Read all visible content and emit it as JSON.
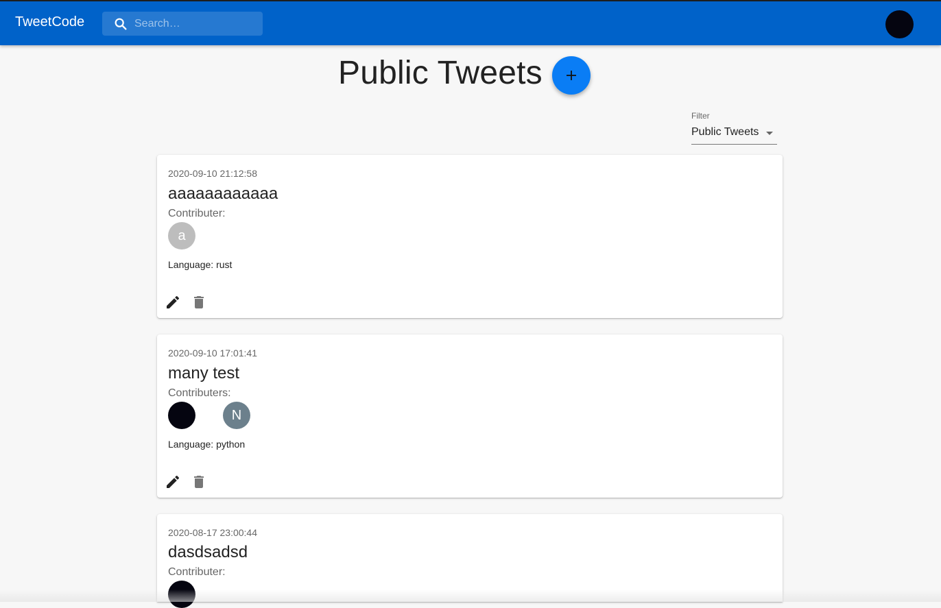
{
  "appbar": {
    "brand": "TweetCode",
    "search_placeholder": "Search…",
    "brand_color": "#0062c9"
  },
  "page": {
    "title": "Public Tweets"
  },
  "filter": {
    "label": "Filter",
    "selected": "Public Tweets"
  },
  "tweets": [
    {
      "date": "2020-09-10 21:12:58",
      "title": "aaaaaaaaaaaa",
      "contributors_label": "Contributer:",
      "contributors": [
        {
          "initial": "a",
          "color": "#bdbdbd"
        }
      ],
      "language": "Language: rust"
    },
    {
      "date": "2020-09-10 17:01:41",
      "title": "many test",
      "contributors_label": "Contributers:",
      "contributors": [
        {
          "initial": "",
          "color": "#050510"
        },
        {
          "initial": "N",
          "color": "#6c808c"
        }
      ],
      "language": "Language: python"
    },
    {
      "date": "2020-08-17 23:00:44",
      "title": "dasdsadsd",
      "contributors_label": "Contributer:",
      "contributors": [
        {
          "initial": "",
          "color": "#050510"
        }
      ],
      "language": ""
    }
  ]
}
